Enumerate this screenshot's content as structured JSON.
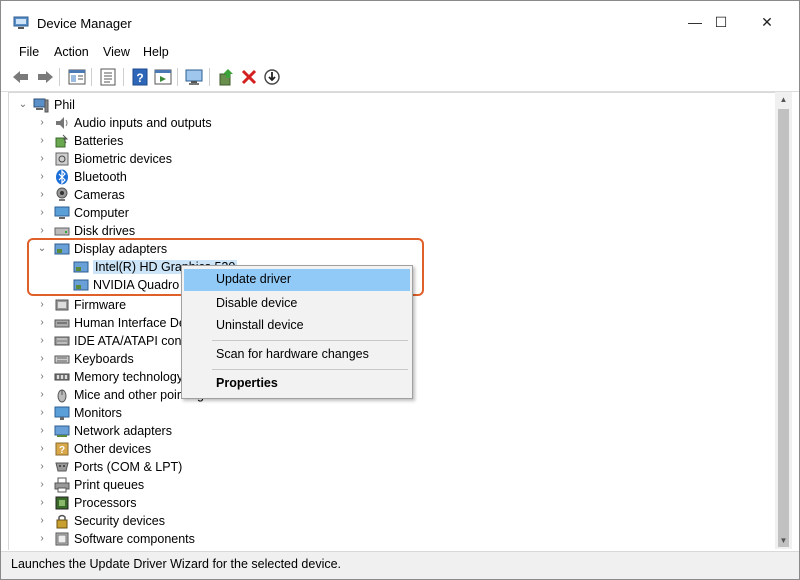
{
  "window": {
    "title": "Device Manager",
    "controls": {
      "minimize": "—",
      "maximize": "☐",
      "close": "✕"
    }
  },
  "menu": [
    "File",
    "Action",
    "View",
    "Help"
  ],
  "toolbar": {
    "buttons": [
      "back-icon",
      "forward-icon",
      "show-hide-console-tree-icon",
      "properties-icon",
      "help-icon",
      "run-icon",
      "scan-hardware-icon",
      "update-driver-icon",
      "uninstall-icon",
      "enable-device-icon"
    ]
  },
  "tree": {
    "root": "Phil",
    "categories": [
      {
        "label": "Audio inputs and outputs",
        "icon": "speaker-icon"
      },
      {
        "label": "Batteries",
        "icon": "battery-icon"
      },
      {
        "label": "Biometric devices",
        "icon": "biometric-icon"
      },
      {
        "label": "Bluetooth",
        "icon": "bluetooth-icon"
      },
      {
        "label": "Cameras",
        "icon": "camera-icon"
      },
      {
        "label": "Computer",
        "icon": "computer-icon"
      },
      {
        "label": "Disk drives",
        "icon": "disk-drive-icon"
      },
      {
        "label": "Display adapters",
        "icon": "display-adapter-icon",
        "expanded": true
      },
      {
        "label": "Intel(R) HD Graphics 520",
        "icon": "display-adapter-icon",
        "child": true
      },
      {
        "label": "NVIDIA Quadro M",
        "icon": "display-adapter-icon",
        "child": true
      },
      {
        "label": "Firmware",
        "icon": "firmware-icon"
      },
      {
        "label": "Human Interface Devices",
        "icon": "hid-icon"
      },
      {
        "label": "IDE ATA/ATAPI controllers",
        "icon": "ide-controller-icon"
      },
      {
        "label": "Keyboards",
        "icon": "keyboard-icon"
      },
      {
        "label": "Memory technology devices",
        "icon": "memory-icon"
      },
      {
        "label": "Mice and other pointing devices",
        "icon": "mouse-icon"
      },
      {
        "label": "Monitors",
        "icon": "monitor-icon"
      },
      {
        "label": "Network adapters",
        "icon": "network-adapter-icon"
      },
      {
        "label": "Other devices",
        "icon": "other-devices-icon"
      },
      {
        "label": "Ports (COM & LPT)",
        "icon": "ports-icon"
      },
      {
        "label": "Print queues",
        "icon": "printer-icon"
      },
      {
        "label": "Processors",
        "icon": "processor-icon"
      },
      {
        "label": "Security devices",
        "icon": "security-icon"
      },
      {
        "label": "Software components",
        "icon": "software-component-icon"
      }
    ]
  },
  "context_menu": {
    "items": [
      "Update driver",
      "Disable device",
      "Uninstall device",
      "Scan for hardware changes",
      "Properties"
    ]
  },
  "status": "Launches the Update Driver Wizard for the selected device.",
  "colors": {
    "highlight_border": "#e0602a",
    "menu_active": "#91c9f7"
  }
}
